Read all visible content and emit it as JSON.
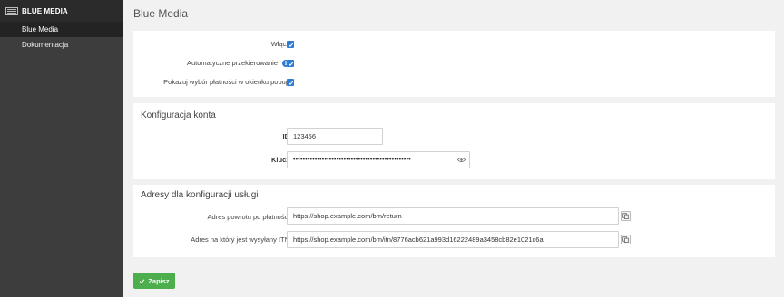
{
  "sidebar": {
    "brand": "BLUE MEDIA",
    "items": [
      {
        "label": "Blue Media",
        "active": true
      },
      {
        "label": "Dokumentacja",
        "active": false
      }
    ]
  },
  "main": {
    "title": "Blue Media",
    "general": {
      "enable_label": "Włącz",
      "enable_checked": true,
      "auto_redirect_label": "Automatyczne przekierowanie",
      "auto_redirect_checked": true,
      "popup_label": "Pokazuj wybór płatności w okienku popup",
      "popup_checked": true
    },
    "account": {
      "title": "Konfiguracja konta",
      "id_label": "ID",
      "id_value": "123456",
      "key_label": "Klucz",
      "key_value_masked": "•••••••••••••••••••••••••••••••••••••••••••••••••"
    },
    "addresses": {
      "title": "Adresy dla konfiguracji usługi",
      "return_label": "Adres powrotu po płatności",
      "return_value": "https://shop.example.com/bm/return",
      "itn_label": "Adres na który jest wysyłany ITN",
      "itn_value": "https://shop.example.com/bm/itn/8776acb621a993d16222489a3458cb82e1021c6a"
    },
    "save_label": "Zapisz"
  },
  "colors": {
    "sidebar_bg": "#3d3d3d",
    "sidebar_active": "#232323",
    "accent_blue": "#2d7cd6",
    "save_green": "#4cae4c"
  }
}
